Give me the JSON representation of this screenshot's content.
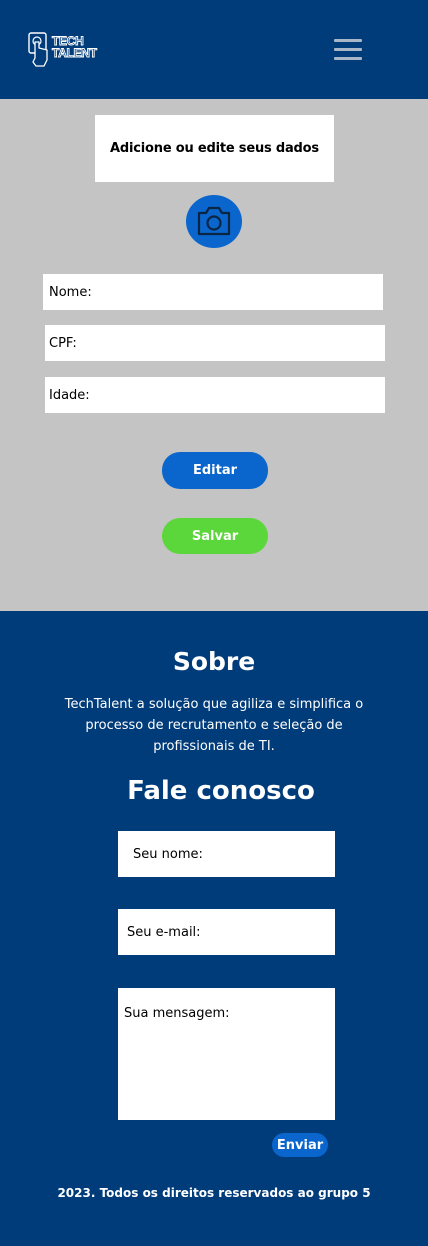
{
  "header": {
    "logo": {
      "line1": "TECH",
      "line2": "TALENT",
      "icon": "hand-pointer-icon"
    },
    "menu_icon": "hamburger-menu-icon"
  },
  "profile": {
    "title": "Adicione ou edite seus dados",
    "camera_icon": "camera-icon",
    "fields": {
      "name_placeholder": "Nome:",
      "cpf_placeholder": "CPF:",
      "age_placeholder": "Idade:"
    },
    "edit_label": "Editar",
    "save_label": "Salvar"
  },
  "footer": {
    "about_title": "Sobre",
    "about_text": "TechTalent a solução que agiliza e simplifica o processo de recrutamento e seleção de profissionais de TI.",
    "contact_title": "Fale conosco",
    "contact": {
      "name_placeholder": "Seu nome:",
      "email_placeholder": "Seu e-mail:",
      "message_placeholder": "Sua mensagem:",
      "send_label": "Enviar"
    },
    "copyright": "2023. Todos os direitos reservados ao grupo 5"
  },
  "colors": {
    "brand_navy": "#003b7a",
    "primary_blue": "#0a66cc",
    "save_green": "#5bd63b",
    "main_bg": "#c4c4c4"
  }
}
